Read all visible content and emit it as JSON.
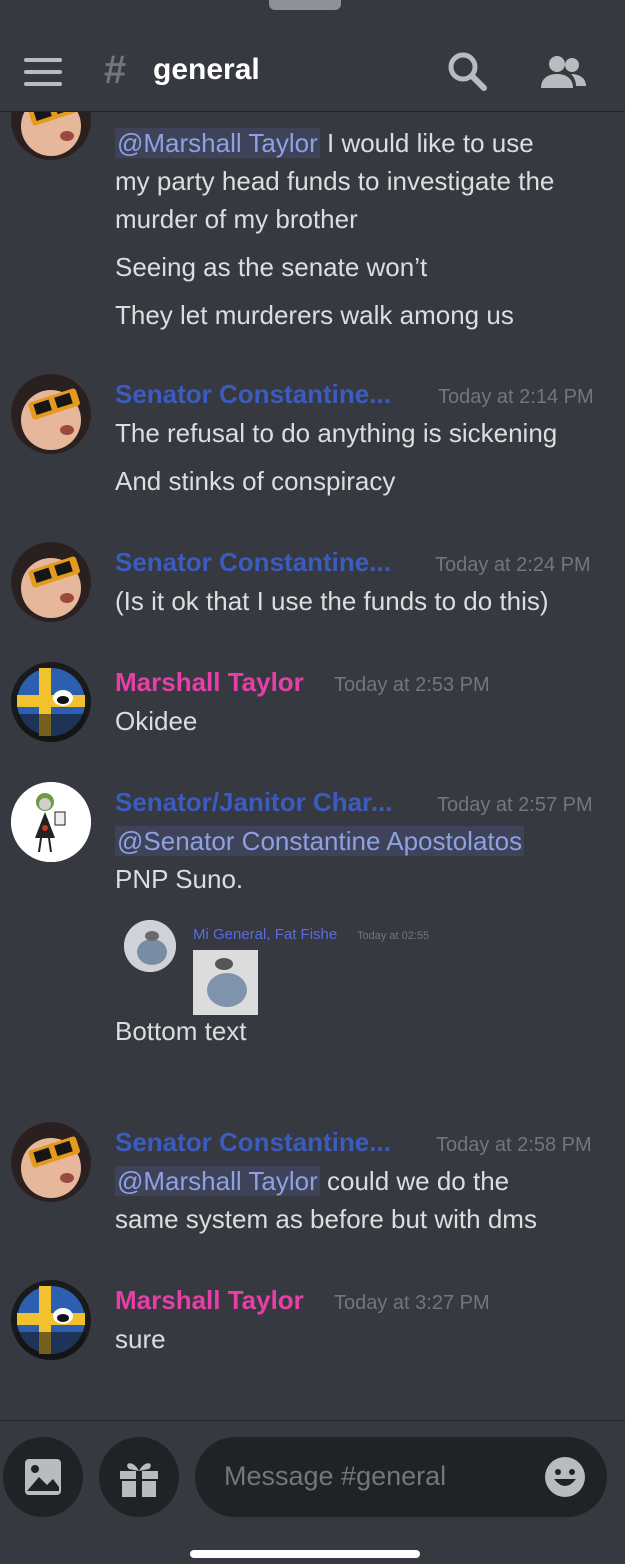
{
  "header": {
    "channel": "general",
    "hash": "#"
  },
  "messages": [
    {
      "lines": [
        "I would like to use",
        "my party head funds to investigate the",
        "murder of my brother",
        "Seeing as the senate won’t",
        "They let murderers walk among us"
      ],
      "mention": "@Marshall Taylor"
    },
    {
      "author": "Senator Constantine...",
      "time": "Today at 2:14 PM",
      "lines": [
        "The refusal to do anything is sickening",
        "And stinks of conspiracy"
      ]
    },
    {
      "author": "Senator Constantine...",
      "time": "Today at 2:24 PM",
      "lines": [
        "(Is it ok that I use the funds to do this)"
      ]
    },
    {
      "author": "Marshall Taylor",
      "time": "Today at 2:53 PM",
      "lines": [
        "Okidee"
      ]
    },
    {
      "author": "Senator/Janitor Char...",
      "time": "Today at 2:57 PM",
      "mention": "@Senator Constantine Apostolatos",
      "lines": [
        "PNP Suno.",
        "Bottom text"
      ],
      "embed": {
        "author": "Mi General, Fat Fishe",
        "time": "Today at 02:55"
      }
    },
    {
      "author": "Senator Constantine...",
      "time": "Today at 2:58 PM",
      "mention": "@Marshall Taylor",
      "lines": [
        "could we do the",
        "same system as before but with dms"
      ]
    },
    {
      "author": "Marshall Taylor",
      "time": "Today at 3:27 PM",
      "lines": [
        "sure"
      ]
    }
  ],
  "composer": {
    "placeholder": "Message #general"
  },
  "colors": {
    "background": "#36393f",
    "senator_name": "#3b5bbf",
    "marshall_name": "#e93ea8",
    "mention_bg": "#3e4359",
    "mention_text": "#8ea1e1"
  },
  "icons": [
    "menu-icon",
    "hash-icon",
    "search-icon",
    "members-icon",
    "image-icon",
    "gift-icon",
    "emoji-icon"
  ]
}
